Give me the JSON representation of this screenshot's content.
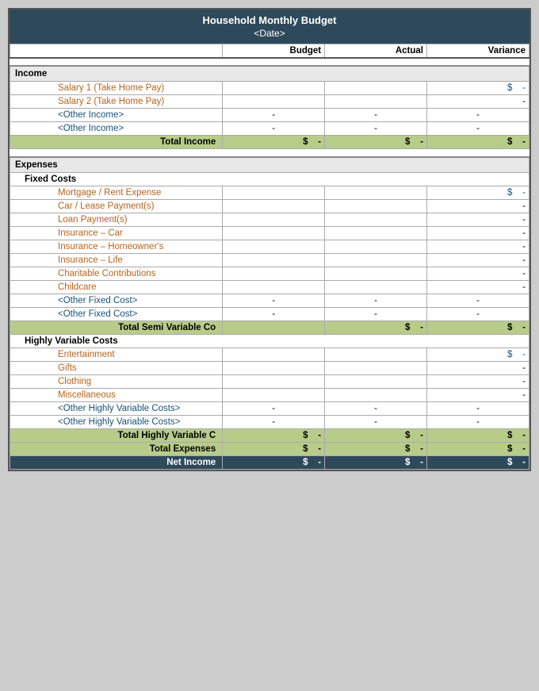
{
  "header": {
    "title": "Household Monthly Budget",
    "date": "<Date>"
  },
  "columns": {
    "label": "",
    "budget": "Budget",
    "actual": "Actual",
    "variance": "Variance"
  },
  "sections": {
    "income": {
      "label": "Income",
      "rows": [
        {
          "label": "Salary 1 (Take Home Pay)",
          "budget": "",
          "actual": "",
          "variance_dollar": "$",
          "variance": "-",
          "type": "salary"
        },
        {
          "label": "Salary 2 (Take Home Pay)",
          "budget": "",
          "actual": "",
          "variance_dollar": "",
          "variance": "-",
          "type": "salary"
        },
        {
          "label": "<Other Income>",
          "budget": "-",
          "actual": "-",
          "variance": "-",
          "type": "other"
        },
        {
          "label": "<Other Income>",
          "budget": "-",
          "actual": "-",
          "variance": "-",
          "type": "other"
        }
      ],
      "total": {
        "label": "Total Income",
        "b_dollar": "$",
        "b_val": "-",
        "a_dollar": "$",
        "a_val": "-",
        "v_dollar": "$",
        "v_val": "-"
      }
    },
    "expenses": {
      "label": "Expenses",
      "fixed": {
        "label": "Fixed Costs",
        "rows": [
          {
            "label": "Mortgage / Rent Expense",
            "budget": "",
            "actual": "",
            "variance_dollar": "$",
            "variance": "-",
            "type": "item"
          },
          {
            "label": "Car / Lease Payment(s)",
            "budget": "",
            "actual": "",
            "variance": "-",
            "type": "item"
          },
          {
            "label": "Loan Payment(s)",
            "budget": "",
            "actual": "",
            "variance": "-",
            "type": "item"
          },
          {
            "label": "Insurance – Car",
            "budget": "",
            "actual": "",
            "variance": "-",
            "type": "item"
          },
          {
            "label": "Insurance – Homeowner's",
            "budget": "",
            "actual": "",
            "variance": "-",
            "type": "item"
          },
          {
            "label": "Insurance – Life",
            "budget": "",
            "actual": "",
            "variance": "-",
            "type": "item"
          },
          {
            "label": "Charitable Contributions",
            "budget": "",
            "actual": "",
            "variance": "-",
            "type": "item"
          },
          {
            "label": "Childcare",
            "budget": "",
            "actual": "",
            "variance": "-",
            "type": "item"
          },
          {
            "label": "<Other Fixed Cost>",
            "budget": "-",
            "actual": "-",
            "variance": "-",
            "type": "other"
          },
          {
            "label": "<Other Fixed Cost>",
            "budget": "-",
            "actual": "-",
            "variance": "-",
            "type": "other"
          }
        ],
        "total": {
          "label": "Total Semi Variable Co",
          "a_dollar": "$",
          "a_val": "-",
          "v_dollar": "$",
          "v_val": "-"
        }
      },
      "variable": {
        "label": "Highly Variable Costs",
        "rows": [
          {
            "label": "Entertainment",
            "budget": "",
            "actual": "",
            "variance_dollar": "$",
            "variance": "-",
            "type": "item"
          },
          {
            "label": "Gifts",
            "budget": "",
            "actual": "",
            "variance": "-",
            "type": "item"
          },
          {
            "label": "Clothing",
            "budget": "",
            "actual": "",
            "variance": "-",
            "type": "item"
          },
          {
            "label": "Miscellaneous",
            "budget": "",
            "actual": "",
            "variance": "-",
            "type": "item"
          },
          {
            "label": "<Other Highly Variable Costs>",
            "budget": "-",
            "actual": "-",
            "variance": "-",
            "type": "other"
          },
          {
            "label": "<Other Highly Variable Costs>",
            "budget": "-",
            "actual": "-",
            "variance": "-",
            "type": "other"
          }
        ],
        "total_variable": {
          "label": "Total Highly Variable C",
          "b_dollar": "$",
          "b_val": "-",
          "a_dollar": "$",
          "a_val": "-",
          "v_dollar": "$",
          "v_val": "-"
        },
        "total_expenses": {
          "label": "Total Expenses",
          "b_dollar": "$",
          "b_val": "-",
          "a_dollar": "$",
          "a_val": "-",
          "v_dollar": "$",
          "v_val": "-"
        }
      }
    },
    "net_income": {
      "label": "Net Income",
      "b_dollar": "$",
      "b_val": "-",
      "a_dollar": "$",
      "a_val": "-",
      "v_dollar": "$",
      "v_val": "-"
    }
  }
}
